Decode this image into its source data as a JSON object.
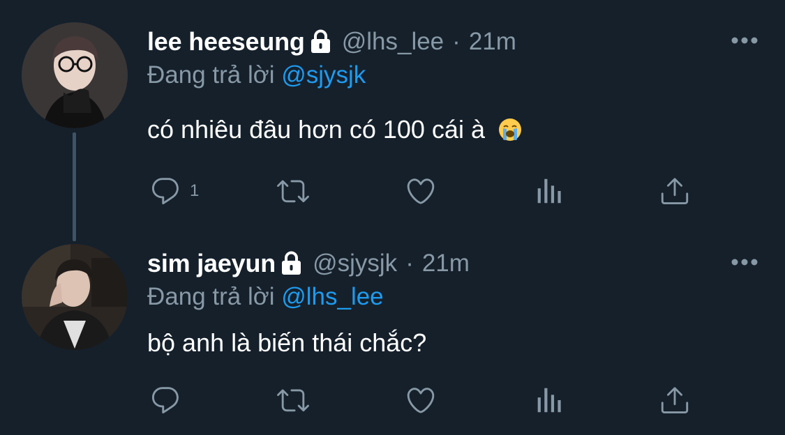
{
  "tweets": [
    {
      "display_name": "lee heeseung",
      "handle": "@lhs_lee",
      "separator": "·",
      "time": "21m",
      "reply_prefix": "Đang trả lời",
      "reply_to": "@sjysjk",
      "text": "có nhiêu đâu hơn có 100 cái à",
      "emoji": "loudly-crying-face-emoji",
      "reply_count": "1"
    },
    {
      "display_name": "sim jaeyun",
      "handle": "@sjysjk",
      "separator": "·",
      "time": "21m",
      "reply_prefix": "Đang trả lời",
      "reply_to": "@lhs_lee",
      "text": "bộ anh là biến thái chắc?",
      "reply_count": ""
    }
  ],
  "icons": {
    "protected": "lock-icon",
    "more": "more-icon",
    "reply": "reply-icon",
    "retweet": "retweet-icon",
    "like": "heart-icon",
    "analytics": "analytics-icon",
    "share": "share-icon"
  },
  "colors": {
    "background": "#15202b",
    "text": "#ffffff",
    "secondary": "#8899a6",
    "accent": "#1d9bf0",
    "thread_line": "#3d5466"
  }
}
